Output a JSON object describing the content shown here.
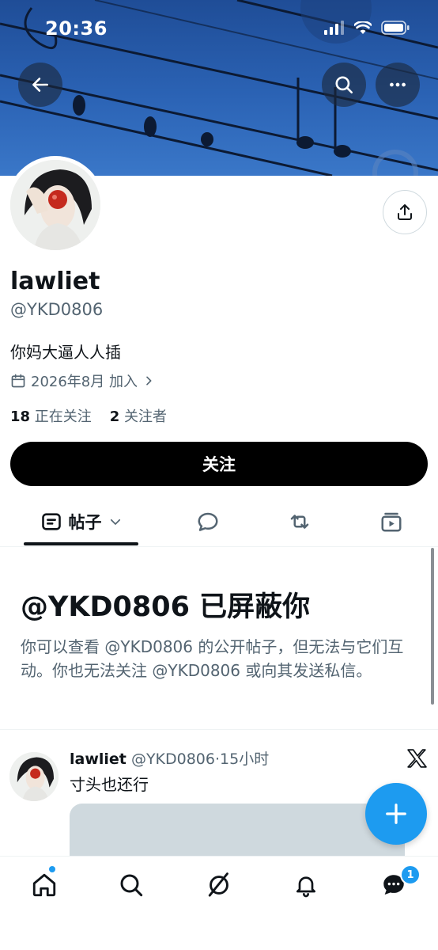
{
  "status_bar": {
    "time": "20:36"
  },
  "profile": {
    "name": "lawliet",
    "handle": "@YKD0806",
    "bio": "你妈大逼人人插",
    "joined": "2026年8月 加入",
    "following_count": "18",
    "following_label": "正在关注",
    "followers_count": "2",
    "followers_label": "关注者",
    "follow_button": "关注"
  },
  "tabs": {
    "posts_label": "帖子"
  },
  "blocked": {
    "title": "@YKD0806 已屏蔽你",
    "description": "你可以查看 @YKD0806 的公开帖子，但无法与它们互动。你也无法关注 @YKD0806 或向其发送私信。"
  },
  "post": {
    "author_name": "lawliet",
    "author_handle": "@YKD0806",
    "separator": "·",
    "time": "15小时",
    "text": "寸头也还行"
  },
  "bottom_nav": {
    "messages_badge": "1"
  },
  "colors": {
    "accent": "#1d9bf0",
    "text": "#0f1419",
    "secondary": "#536471",
    "banner": "#2b63b5"
  },
  "icons": [
    "back-arrow-icon",
    "search-icon",
    "more-icon",
    "share-icon",
    "calendar-icon",
    "chevron-right-icon",
    "posts-tab-icon",
    "chevron-down-icon",
    "replies-icon",
    "retweet-icon",
    "media-icon",
    "x-logo-icon",
    "plus-icon",
    "home-icon",
    "explore-icon",
    "grok-icon",
    "bell-icon",
    "messages-icon"
  ]
}
